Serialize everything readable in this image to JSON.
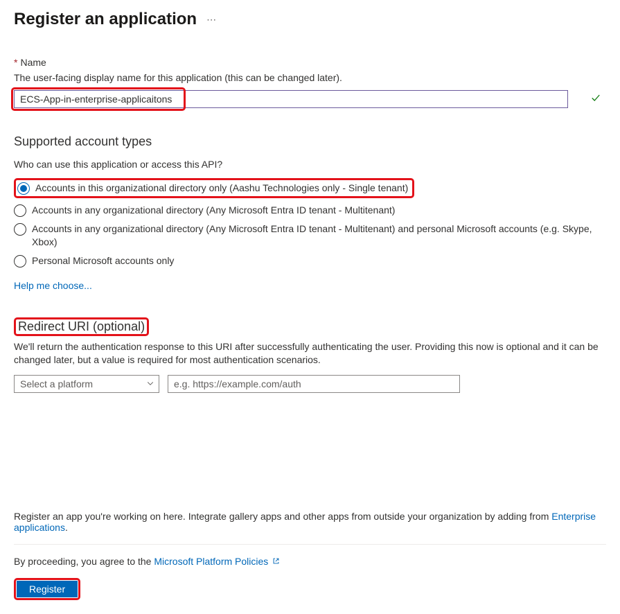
{
  "header": {
    "title": "Register an application"
  },
  "name": {
    "label": "Name",
    "hint": "The user-facing display name for this application (this can be changed later).",
    "value": "ECS-App-in-enterprise-applicaitons"
  },
  "accountTypes": {
    "heading": "Supported account types",
    "question": "Who can use this application or access this API?",
    "options": [
      "Accounts in this organizational directory only (Aashu Technologies only - Single tenant)",
      "Accounts in any organizational directory (Any Microsoft Entra ID tenant - Multitenant)",
      "Accounts in any organizational directory (Any Microsoft Entra ID tenant - Multitenant) and personal Microsoft accounts (e.g. Skype, Xbox)",
      "Personal Microsoft accounts only"
    ],
    "helpLink": "Help me choose..."
  },
  "redirect": {
    "heading": "Redirect URI (optional)",
    "description": "We'll return the authentication response to this URI after successfully authenticating the user. Providing this now is optional and it can be changed later, but a value is required for most authentication scenarios.",
    "platformPlaceholder": "Select a platform",
    "uriPlaceholder": "e.g. https://example.com/auth"
  },
  "footer": {
    "text": "Register an app you're working on here. Integrate gallery apps and other apps from outside your organization by adding from ",
    "link": "Enterprise applications",
    "period": ".",
    "policyPrefix": "By proceeding, you agree to the ",
    "policyLink": "Microsoft Platform Policies",
    "registerLabel": "Register"
  }
}
